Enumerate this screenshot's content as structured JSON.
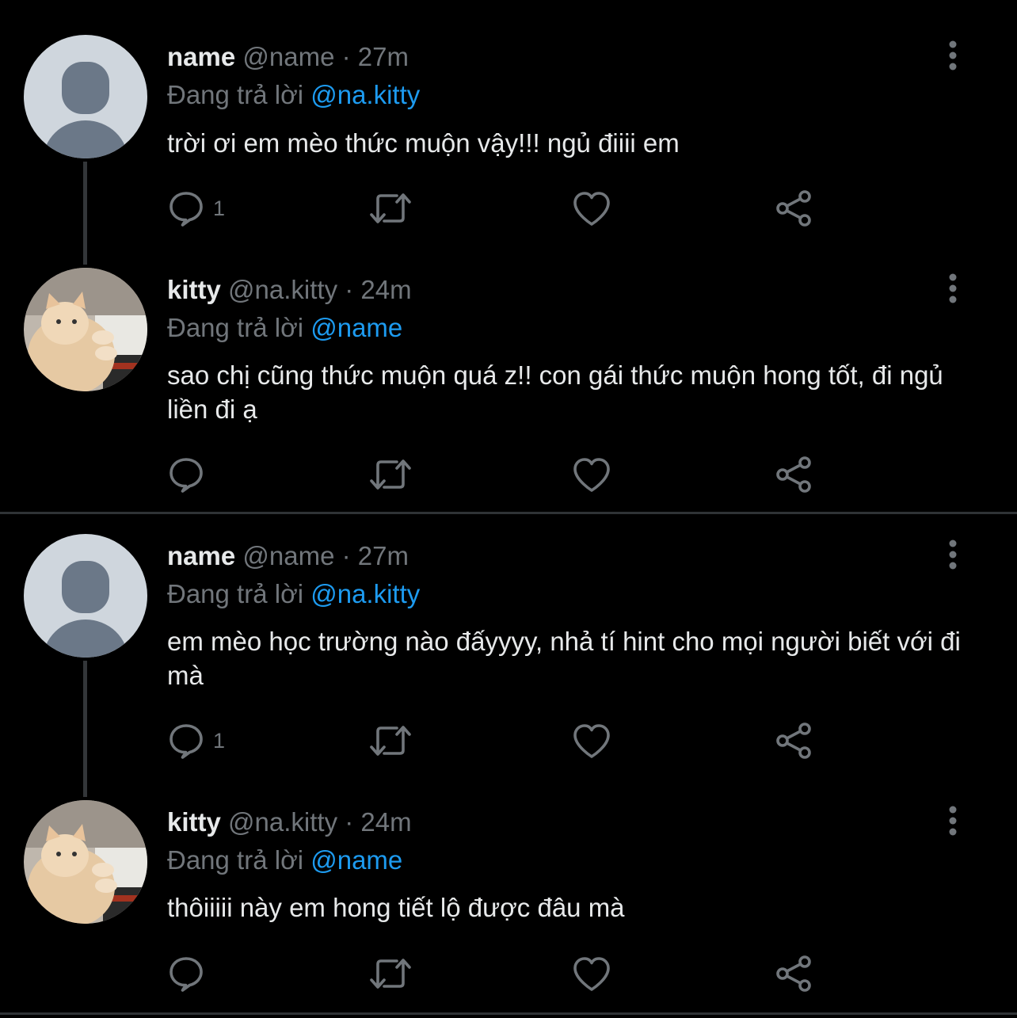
{
  "reply_prefix": "Đang trả lời",
  "colors": {
    "background": "#000000",
    "accent": "#1d9bf0",
    "muted": "#71767b",
    "text": "#e7e9ea"
  },
  "threads": [
    {
      "parent": {
        "display_name": "name",
        "handle": "@name",
        "time": "27m",
        "reply_to": "@na.kitty",
        "text": "trời ơi em mèo thức muộn vậy!!! ngủ điiii em",
        "reply_count": "1",
        "avatar": "default-avatar"
      },
      "reply": {
        "display_name": "kitty",
        "handle": "@na.kitty",
        "time": "24m",
        "reply_to": "@name",
        "text": "sao chị cũng thức muộn quá z!! con gái thức muộn hong tốt, đi ngủ liền đi ạ",
        "reply_count": "",
        "avatar": "cat-avatar"
      }
    },
    {
      "parent": {
        "display_name": "name",
        "handle": "@name",
        "time": "27m",
        "reply_to": "@na.kitty",
        "text": "em mèo học trường nào đấyyyy, nhả tí hint cho mọi người biết với đi mà",
        "reply_count": "1",
        "avatar": "default-avatar"
      },
      "reply": {
        "display_name": "kitty",
        "handle": "@na.kitty",
        "time": "24m",
        "reply_to": "@name",
        "text": "thôiiiii này em hong tiết lộ được đâu mà",
        "reply_count": "",
        "avatar": "cat-avatar"
      }
    }
  ],
  "icons": {
    "reply": "speech-bubble-icon",
    "retweet": "retweet-arrows-icon",
    "like": "heart-icon",
    "share": "share-icon",
    "more": "vertical-dots-icon"
  }
}
